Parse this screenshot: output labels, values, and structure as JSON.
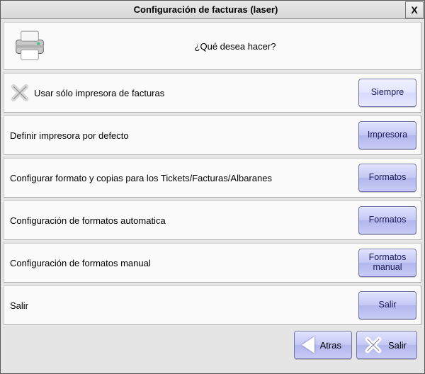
{
  "title": "Configuración de facturas (laser)",
  "close_label": "X",
  "header_question": "¿Qué desea hacer?",
  "rows": [
    {
      "label": "Usar sólo impresora de facturas",
      "button": "Siempre",
      "has_x": true,
      "light": true
    },
    {
      "label": "Definir impresora por defecto",
      "button": "Impresora",
      "has_x": false,
      "light": false
    },
    {
      "label": "Configurar formato y copias para los Tickets/Facturas/Albaranes",
      "button": "Formatos",
      "has_x": false,
      "light": false
    },
    {
      "label": "Configuración de formatos automatica",
      "button": "Formatos",
      "has_x": false,
      "light": false
    },
    {
      "label": "Configuración de formatos manual",
      "button": "Formatos manual",
      "has_x": false,
      "light": false
    },
    {
      "label": "Salir",
      "button": "Salir",
      "has_x": false,
      "light": false
    }
  ],
  "footer": {
    "back_label": "Atras",
    "exit_label": "Salir"
  }
}
